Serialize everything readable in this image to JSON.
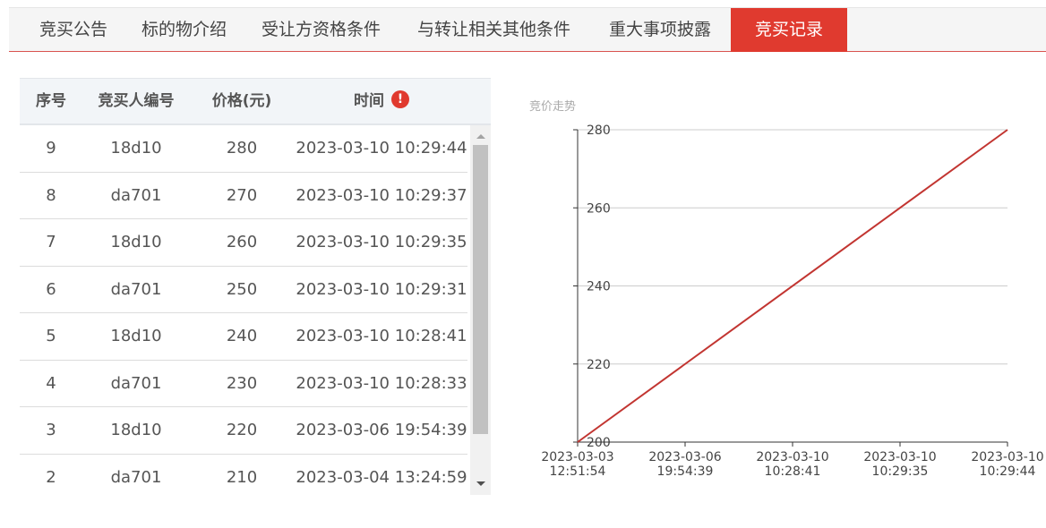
{
  "tabs": [
    {
      "label": "竞买公告"
    },
    {
      "label": "标的物介绍"
    },
    {
      "label": "受让方资格条件"
    },
    {
      "label": "与转让相关其他条件"
    },
    {
      "label": "重大事项披露"
    },
    {
      "label": "竞买记录",
      "active": true
    }
  ],
  "table": {
    "headers": [
      "序号",
      "竞买人编号",
      "价格(元)",
      "时间"
    ],
    "info_icon": "!",
    "rows": [
      [
        "9",
        "18d10",
        "280",
        "2023-03-10 10:29:44"
      ],
      [
        "8",
        "da701",
        "270",
        "2023-03-10 10:29:37"
      ],
      [
        "7",
        "18d10",
        "260",
        "2023-03-10 10:29:35"
      ],
      [
        "6",
        "da701",
        "250",
        "2023-03-10 10:29:31"
      ],
      [
        "5",
        "18d10",
        "240",
        "2023-03-10 10:28:41"
      ],
      [
        "4",
        "da701",
        "230",
        "2023-03-10 10:28:33"
      ],
      [
        "3",
        "18d10",
        "220",
        "2023-03-06 19:54:39"
      ],
      [
        "2",
        "da701",
        "210",
        "2023-03-04 13:24:59"
      ]
    ]
  },
  "chart_data": {
    "type": "line",
    "title": "竞价走势",
    "color": "#c23531",
    "ylim": [
      200,
      280
    ],
    "y_ticks": [
      200,
      220,
      240,
      260,
      280
    ],
    "x_ticks": [
      [
        "2023-03-03",
        "12:51:54"
      ],
      [
        "2023-03-06",
        "19:54:39"
      ],
      [
        "2023-03-10",
        "10:28:41"
      ],
      [
        "2023-03-10",
        "10:29:35"
      ],
      [
        "2023-03-10",
        "10:29:44"
      ]
    ],
    "series": [
      {
        "x": [
          "2023-03-03 12:51:54",
          "2023-03-10 10:29:44"
        ],
        "values": [
          200,
          280
        ]
      }
    ],
    "grid": true
  }
}
